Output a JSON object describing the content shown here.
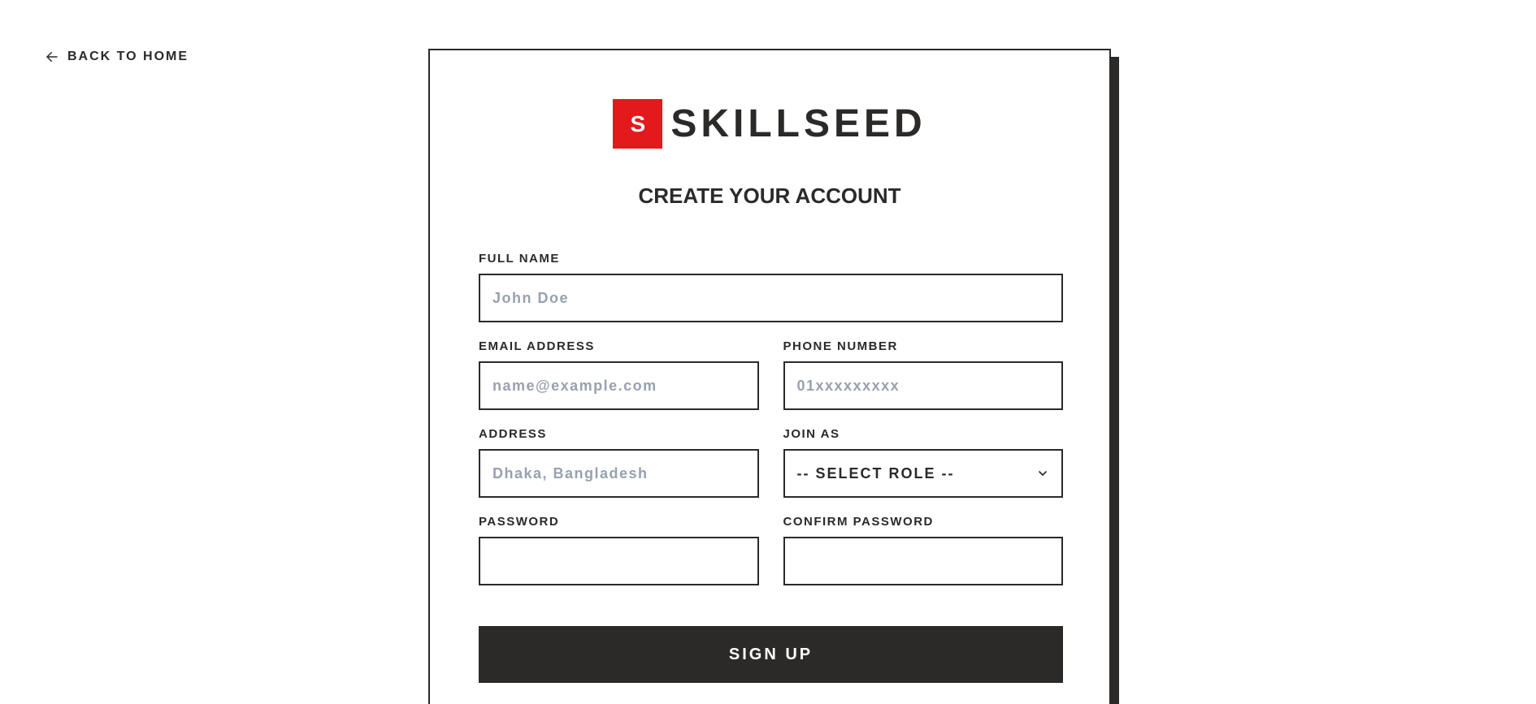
{
  "nav": {
    "back_label": "BACK TO HOME",
    "back_icon": "arrow-left-icon"
  },
  "brand": {
    "mark_letter": "S",
    "name": "SKILLSEED",
    "accent_color": "#e3191b",
    "text_color": "#2b2a29"
  },
  "form": {
    "title": "CREATE YOUR ACCOUNT",
    "full_name": {
      "label": "FULL NAME",
      "value": "",
      "placeholder": "John Doe"
    },
    "email": {
      "label": "EMAIL ADDRESS",
      "value": "",
      "placeholder": "name@example.com"
    },
    "phone": {
      "label": "PHONE NUMBER",
      "value": "",
      "placeholder": "01xxxxxxxxx"
    },
    "address": {
      "label": "ADDRESS",
      "value": "",
      "placeholder": "Dhaka, Bangladesh"
    },
    "role": {
      "label": "JOIN AS",
      "selected": "-- SELECT ROLE --",
      "icon": "chevron-down-icon"
    },
    "password": {
      "label": "PASSWORD",
      "value": "",
      "placeholder": ""
    },
    "confirm_password": {
      "label": "CONFIRM PASSWORD",
      "value": "",
      "placeholder": ""
    },
    "submit_label": "SIGN UP"
  }
}
